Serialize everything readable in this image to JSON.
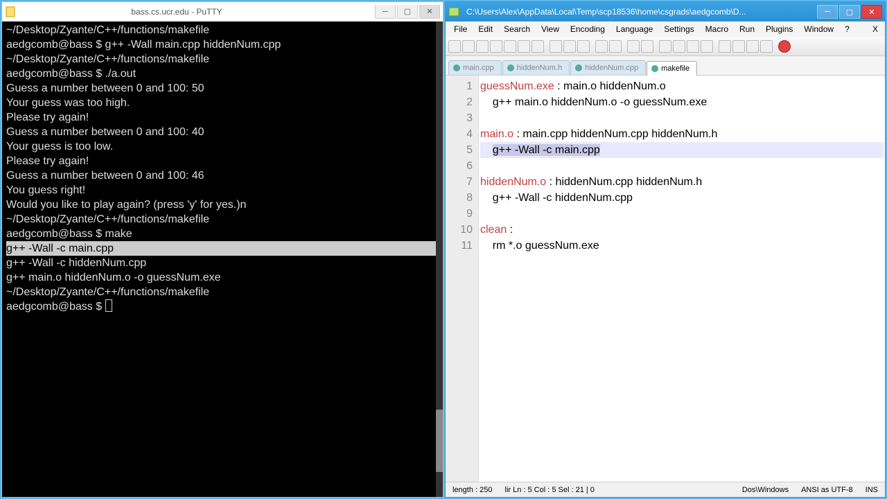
{
  "putty": {
    "title": "bass.cs.ucr.edu - PuTTY",
    "lines": [
      {
        "text": "~/Desktop/Zyante/C++/functions/makefile",
        "hl": false
      },
      {
        "text": "aedgcomb@bass $ g++ -Wall main.cpp hiddenNum.cpp",
        "hl": false
      },
      {
        "text": "~/Desktop/Zyante/C++/functions/makefile",
        "hl": false
      },
      {
        "text": "aedgcomb@bass $ ./a.out",
        "hl": false
      },
      {
        "text": "Guess a number between 0 and 100: 50",
        "hl": false
      },
      {
        "text": "Your guess was too high.",
        "hl": false
      },
      {
        "text": "Please try again!",
        "hl": false
      },
      {
        "text": "Guess a number between 0 and 100: 40",
        "hl": false
      },
      {
        "text": "Your guess is too low.",
        "hl": false
      },
      {
        "text": "Please try again!",
        "hl": false
      },
      {
        "text": "Guess a number between 0 and 100: 46",
        "hl": false
      },
      {
        "text": "You guess right!",
        "hl": false
      },
      {
        "text": "Would you like to play again? (press 'y' for yes.)n",
        "hl": false
      },
      {
        "text": "~/Desktop/Zyante/C++/functions/makefile",
        "hl": false
      },
      {
        "text": "aedgcomb@bass $ make",
        "hl": false
      },
      {
        "text": "g++ -Wall -c main.cpp",
        "hl": true
      },
      {
        "text": "g++ -Wall -c hiddenNum.cpp",
        "hl": false
      },
      {
        "text": "g++ main.o hiddenNum.o -o guessNum.exe",
        "hl": false
      },
      {
        "text": "~/Desktop/Zyante/C++/functions/makefile",
        "hl": false
      },
      {
        "text": "aedgcomb@bass $ ",
        "hl": false,
        "cursor": true
      }
    ]
  },
  "npp": {
    "title": "C:\\Users\\Alex\\AppData\\Local\\Temp\\scp18536\\home\\csgrads\\aedgcomb\\D...",
    "menus": [
      "File",
      "Edit",
      "Search",
      "View",
      "Encoding",
      "Language",
      "Settings",
      "Macro",
      "Run",
      "Plugins",
      "Window",
      "?"
    ],
    "tabs": [
      {
        "label": "main.cpp",
        "active": false
      },
      {
        "label": "hiddenNum.h",
        "active": false
      },
      {
        "label": "hiddenNum.cpp",
        "active": false
      },
      {
        "label": "makefile",
        "active": true
      }
    ],
    "lines": [
      {
        "n": 1,
        "html": "<span class='kw'>guessNum.exe</span> : main.o hiddenNum.o"
      },
      {
        "n": 2,
        "html": "    g++ main.o hiddenNum.o -o guessNum.exe"
      },
      {
        "n": 3,
        "html": ""
      },
      {
        "n": 4,
        "html": "<span class='kw'>main.o</span> : main.cpp hiddenNum.cpp hiddenNum.h"
      },
      {
        "n": 5,
        "html": "    <span class='sel'>g++ -Wall -c main.cpp</span>",
        "current": true
      },
      {
        "n": 6,
        "html": ""
      },
      {
        "n": 7,
        "html": "<span class='kw'>hiddenNum.o</span> : hiddenNum.cpp hiddenNum.h"
      },
      {
        "n": 8,
        "html": "    g++ -Wall -c hiddenNum.cpp"
      },
      {
        "n": 9,
        "html": ""
      },
      {
        "n": 10,
        "html": "<span class='kw'>clean</span> :"
      },
      {
        "n": 11,
        "html": "    rm *.o guessNum.exe"
      }
    ],
    "status": {
      "length": "length : 250",
      "pos": "lir  Ln : 5   Col : 5   Sel : 21 | 0",
      "eol": "Dos\\Windows",
      "enc": "ANSI as UTF-8",
      "mode": "INS"
    }
  }
}
